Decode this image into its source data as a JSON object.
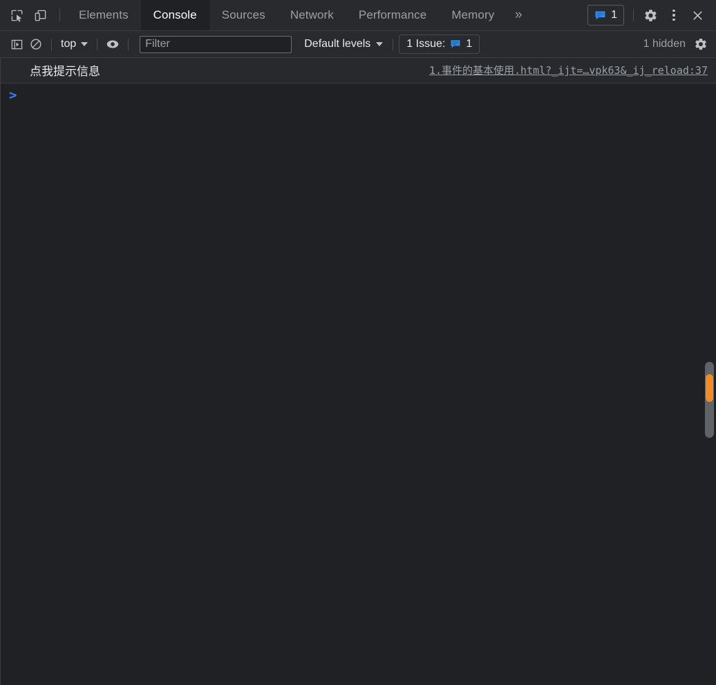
{
  "window": {
    "title": "Chrome DevTools - Console"
  },
  "tabbar": {
    "inspect_icon": "inspect-element-icon",
    "device_icon": "device-toolbar-icon",
    "tabs": [
      {
        "label": "Elements",
        "active": false
      },
      {
        "label": "Console",
        "active": true
      },
      {
        "label": "Sources",
        "active": false
      },
      {
        "label": "Network",
        "active": false
      },
      {
        "label": "Performance",
        "active": false
      },
      {
        "label": "Memory",
        "active": false
      }
    ],
    "more_tabs_label": "»",
    "issues_badge": {
      "icon": "issues-message-icon",
      "count": "1"
    },
    "settings_label": "gear-icon",
    "more_options_label": "kebab-menu-icon",
    "close_label": "✕"
  },
  "console_toolbar": {
    "sidebar_toggle": "console-sidebar-toggle-icon",
    "clear_console": "clear-console-icon",
    "context": {
      "label": "top",
      "caret": "chevron-down-icon"
    },
    "live_expression": "eye-icon",
    "filter": {
      "placeholder": "Filter",
      "value": ""
    },
    "levels": {
      "label": "Default levels",
      "caret": "chevron-down-icon"
    },
    "issues": {
      "label": "1 Issue:",
      "icon": "issues-message-icon",
      "count": "1"
    },
    "hidden_label": "1 hidden",
    "settings_label": "gear-icon"
  },
  "console": {
    "messages": [
      {
        "text": "点我提示信息",
        "source": "1.事件的基本使用.html?_ijt=…vpk63&_ij_reload:37"
      }
    ],
    "prompt": {
      "caret": ">",
      "value": ""
    }
  },
  "scrollbar": {
    "name": "console-scrollbar",
    "thumb_color": "#f08c28",
    "track_color": "#5f6368"
  },
  "colors": {
    "background": "#202124",
    "toolbar": "#292a2d",
    "accent_blue": "#3b82f6",
    "text": "#e8eaed",
    "muted_text": "#9aa0a6"
  }
}
